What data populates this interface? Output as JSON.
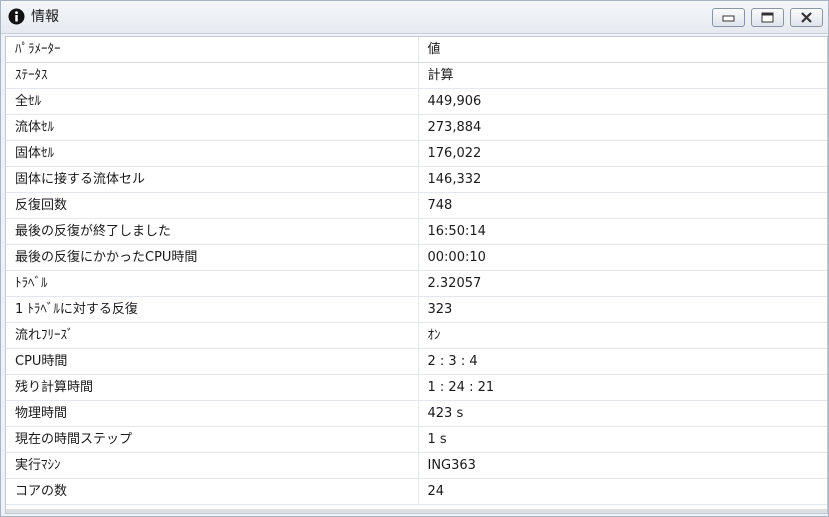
{
  "window": {
    "title": "情報",
    "icon": "info-icon",
    "buttons": {
      "minimize": "minimize-icon",
      "maximize": "maximize-icon",
      "close": "close-icon"
    }
  },
  "table": {
    "headers": {
      "parameter": "ﾊﾟﾗﾒｰﾀｰ",
      "value": "値"
    },
    "rows": [
      {
        "parameter": "ｽﾃｰﾀｽ",
        "value": "計算"
      },
      {
        "parameter": "全ｾﾙ",
        "value": "449,906"
      },
      {
        "parameter": "流体ｾﾙ",
        "value": "273,884"
      },
      {
        "parameter": "固体ｾﾙ",
        "value": "176,022"
      },
      {
        "parameter": "固体に接する流体セル",
        "value": "146,332"
      },
      {
        "parameter": "反復回数",
        "value": "748"
      },
      {
        "parameter": "最後の反復が終了しました",
        "value": "16:50:14"
      },
      {
        "parameter": "最後の反復にかかったCPU時間",
        "value": "00:00:10"
      },
      {
        "parameter": "ﾄﾗﾍﾞﾙ",
        "value": "2.32057"
      },
      {
        "parameter": "1 ﾄﾗﾍﾞﾙに対する反復",
        "value": "323"
      },
      {
        "parameter": "流れﾌﾘｰｽﾞ",
        "value": "ｵﾝ"
      },
      {
        "parameter": "CPU時間",
        "value": "2 : 3 : 4"
      },
      {
        "parameter": "残り計算時間",
        "value": "1 : 24 : 21"
      },
      {
        "parameter": "物理時間",
        "value": "423 s"
      },
      {
        "parameter": "現在の時間ステップ",
        "value": "1 s"
      },
      {
        "parameter": "実行ﾏｼﾝ",
        "value": "ING363"
      },
      {
        "parameter": "コアの数",
        "value": "24"
      }
    ]
  },
  "colors": {
    "window_border": "#a9b4c2",
    "titlebar": "#e6eaf0",
    "grid_line": "#e3e6ea"
  }
}
